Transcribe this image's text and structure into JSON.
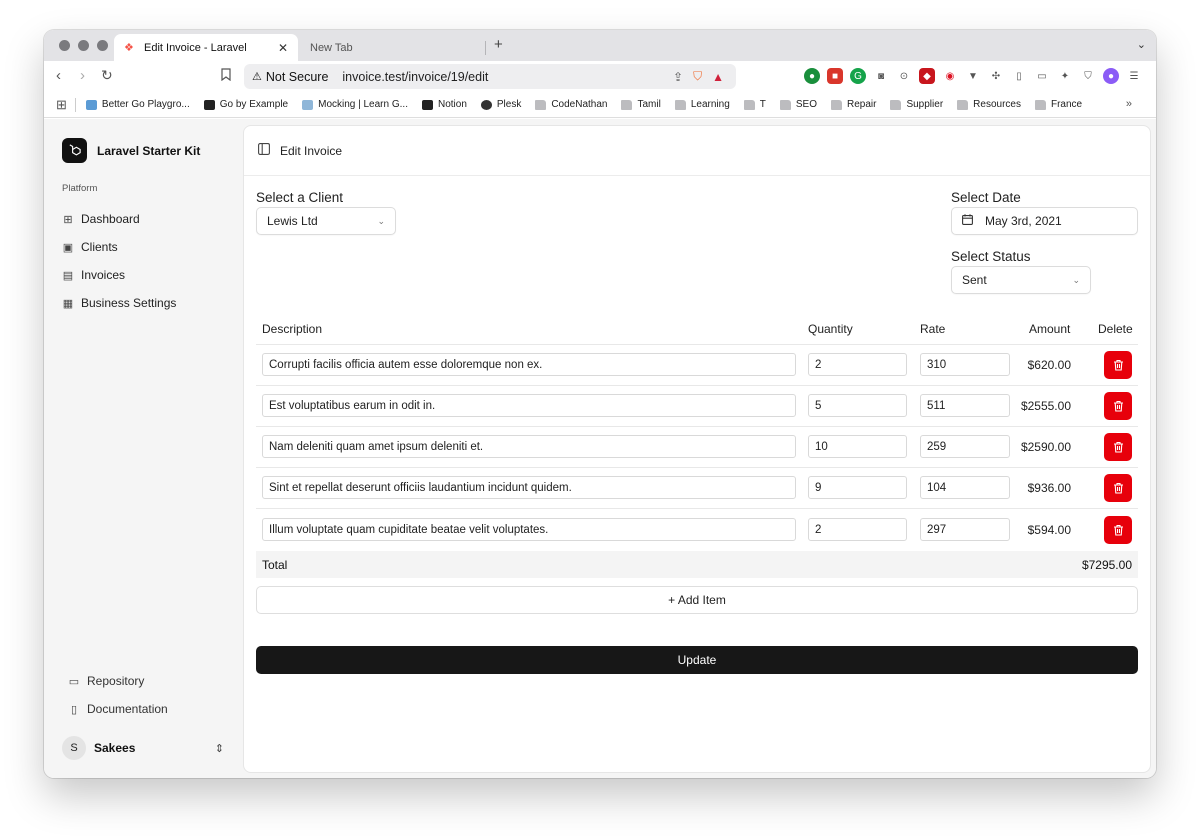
{
  "browser": {
    "tabs": [
      {
        "title": "Edit Invoice - Laravel",
        "active": true
      },
      {
        "title": "New Tab",
        "active": false
      }
    ],
    "new_tab_symbol": "+",
    "security_label": "Not Secure",
    "url": "invoice.test/invoice/19/edit",
    "bookmarks": [
      {
        "label": "Better Go Playgro...",
        "icon": "playground-icon"
      },
      {
        "label": "Go by Example",
        "icon": "code-icon"
      },
      {
        "label": "Mocking | Learn G...",
        "icon": "gopher-icon"
      },
      {
        "label": "Notion",
        "icon": "notion-icon"
      },
      {
        "label": "Plesk",
        "icon": "plesk-icon"
      },
      {
        "label": "CodeNathan",
        "icon": "folder-icon"
      },
      {
        "label": "Tamil",
        "icon": "folder-icon"
      },
      {
        "label": "Learning",
        "icon": "folder-icon"
      },
      {
        "label": "T",
        "icon": "folder-icon"
      },
      {
        "label": "SEO",
        "icon": "folder-icon"
      },
      {
        "label": "Repair",
        "icon": "folder-icon"
      },
      {
        "label": "Supplier",
        "icon": "folder-icon"
      },
      {
        "label": "Resources",
        "icon": "folder-icon"
      },
      {
        "label": "France",
        "icon": "folder-icon"
      }
    ],
    "more_bookmarks": "»"
  },
  "sidebar": {
    "brand": "Laravel Starter Kit",
    "group_label": "Platform",
    "items": [
      {
        "label": "Dashboard",
        "icon": "grid-icon"
      },
      {
        "label": "Clients",
        "icon": "contact-icon"
      },
      {
        "label": "Invoices",
        "icon": "document-icon"
      },
      {
        "label": "Business Settings",
        "icon": "building-icon"
      }
    ],
    "bottom_links": [
      {
        "label": "Repository",
        "icon": "folder-icon"
      },
      {
        "label": "Documentation",
        "icon": "book-icon"
      }
    ],
    "user": {
      "initial": "S",
      "name": "Sakees"
    }
  },
  "header": {
    "title": "Edit Invoice"
  },
  "form": {
    "client_label": "Select a Client",
    "client_value": "Lewis Ltd",
    "date_label": "Select Date",
    "date_value": "May 3rd, 2021",
    "status_label": "Select Status",
    "status_value": "Sent"
  },
  "table": {
    "headers": {
      "description": "Description",
      "quantity": "Quantity",
      "rate": "Rate",
      "amount": "Amount",
      "delete": "Delete"
    },
    "rows": [
      {
        "description": "Corrupti facilis officia autem esse doloremque non ex.",
        "quantity": "2",
        "rate": "310",
        "amount": "$620.00"
      },
      {
        "description": "Est voluptatibus earum in odit in.",
        "quantity": "5",
        "rate": "511",
        "amount": "$2555.00"
      },
      {
        "description": "Nam deleniti quam amet ipsum deleniti et.",
        "quantity": "10",
        "rate": "259",
        "amount": "$2590.00"
      },
      {
        "description": "Sint et repellat deserunt officiis laudantium incidunt quidem.",
        "quantity": "9",
        "rate": "104",
        "amount": "$936.00"
      },
      {
        "description": "Illum voluptate quam cupiditate beatae velit voluptates.",
        "quantity": "2",
        "rate": "297",
        "amount": "$594.00"
      }
    ],
    "total_label": "Total",
    "total_value": "$7295.00"
  },
  "actions": {
    "add_item": "+ Add Item",
    "update": "Update"
  },
  "colors": {
    "delete": "#e7000b",
    "primary": "#171717"
  }
}
